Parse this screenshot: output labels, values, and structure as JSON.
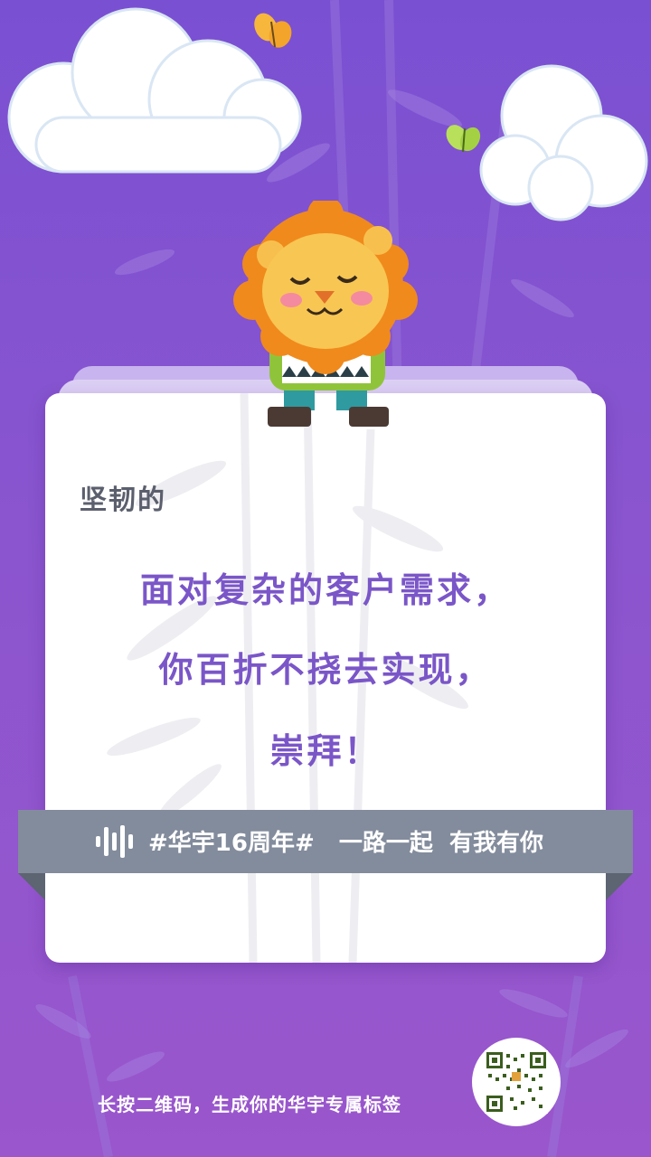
{
  "subtitle": "坚韧的",
  "message": {
    "line1": "面对复杂的客户需求，",
    "line2": "你百折不挠去实现，",
    "line3": "崇拜！"
  },
  "ribbon": {
    "icon": "soundwave-logo-icon",
    "text": "#华宇16周年#   一路一起  有我有你"
  },
  "footer": {
    "instruction": "长按二维码，生成你的华宇专属标签",
    "qr": "qr-code"
  },
  "colors": {
    "background": "#7a50d2",
    "message_text": "#7a56c8",
    "subtitle_text": "#5b5f6d",
    "ribbon": "#838c9c"
  }
}
